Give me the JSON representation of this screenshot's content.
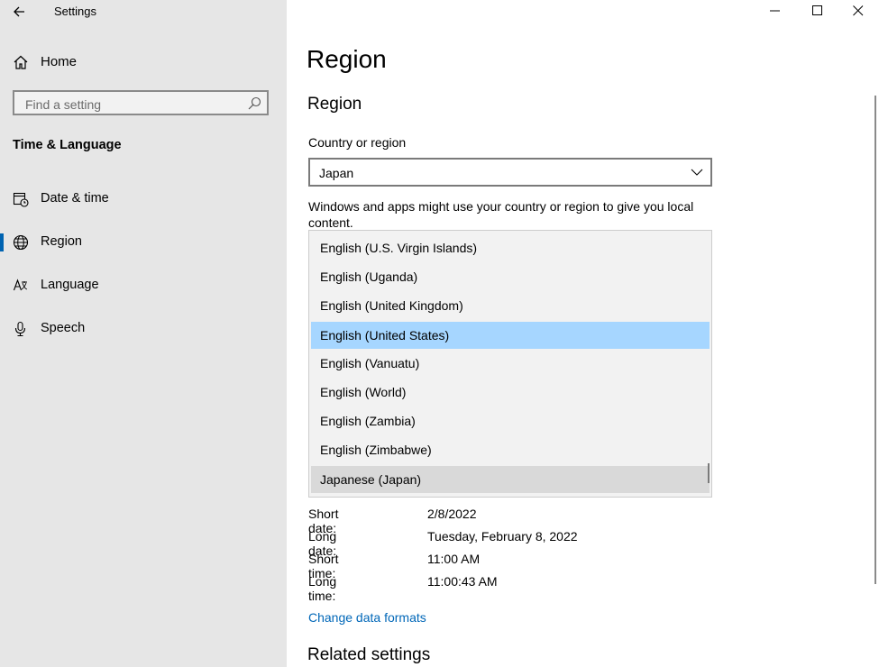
{
  "window": {
    "title": "Settings",
    "controls": [
      "minimize",
      "maximize",
      "close"
    ]
  },
  "sidebar": {
    "home_label": "Home",
    "search_placeholder": "Find a setting",
    "section_title": "Time & Language",
    "items": [
      {
        "label": "Date & time",
        "icon": "calendar-clock-icon"
      },
      {
        "label": "Region",
        "icon": "globe-icon",
        "selected": true
      },
      {
        "label": "Language",
        "icon": "language-icon"
      },
      {
        "label": "Speech",
        "icon": "microphone-icon"
      }
    ]
  },
  "main": {
    "page_title": "Region",
    "section_title": "Region",
    "country_label": "Country or region",
    "country_value": "Japan",
    "description": "Windows and apps might use your country or region to give you local content.",
    "format_dropdown": {
      "options": [
        "English (U.S. Virgin Islands)",
        "English (Uganda)",
        "English (United Kingdom)",
        "English (United States)",
        "English (Vanuatu)",
        "English (World)",
        "English (Zambia)",
        "English (Zimbabwe)",
        "Japanese (Japan)"
      ],
      "highlighted": "English (United States)",
      "current": "Japanese (Japan)"
    },
    "formats": [
      {
        "label": "Short date:",
        "value": "2/8/2022"
      },
      {
        "label": "Long date:",
        "value": "Tuesday, February 8, 2022"
      },
      {
        "label": "Short time:",
        "value": "11:00 AM"
      },
      {
        "label": "Long time:",
        "value": "11:00:43 AM"
      }
    ],
    "change_link": "Change data formats",
    "related_title": "Related settings"
  },
  "colors": {
    "sidebar_bg": "#e6e6e6",
    "highlight": "#a6d6ff",
    "link": "#0067b8",
    "accent": "#0063b1"
  }
}
